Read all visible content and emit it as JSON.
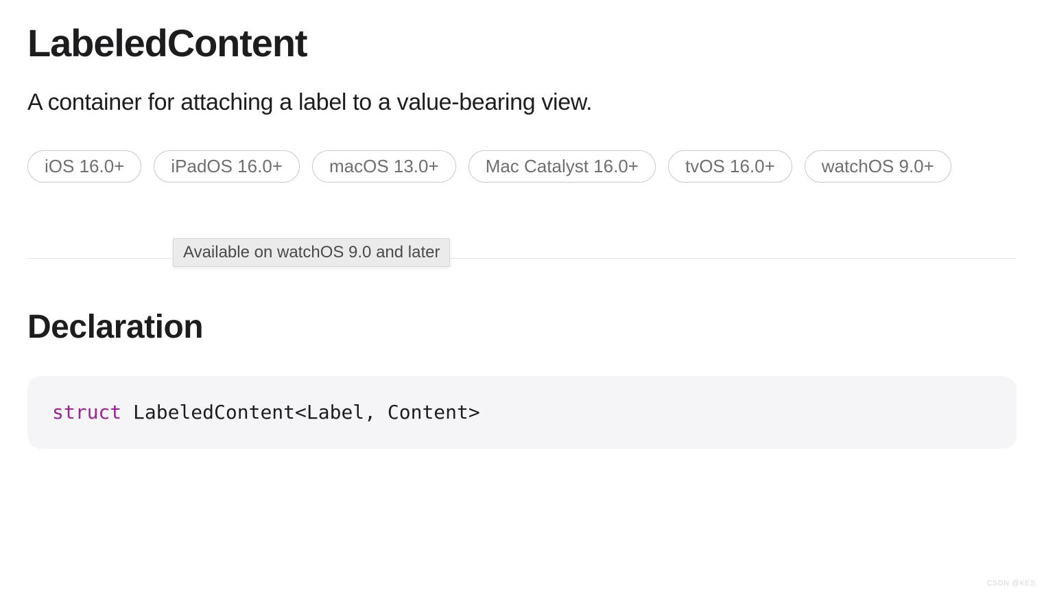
{
  "title": "LabeledContent",
  "subtitle": "A container for attaching a label to a value-bearing view.",
  "platforms": {
    "p0": "iOS 16.0+",
    "p1": "iPadOS 16.0+",
    "p2": "macOS 13.0+",
    "p3": "Mac Catalyst 16.0+",
    "p4": "tvOS 16.0+",
    "p5": "watchOS 9.0+"
  },
  "tooltip": "Available on watchOS 9.0 and later",
  "declaration": {
    "heading": "Declaration",
    "keyword": "struct",
    "rest": " LabeledContent<Label, Content>"
  },
  "watermark": "CSDN @KES"
}
